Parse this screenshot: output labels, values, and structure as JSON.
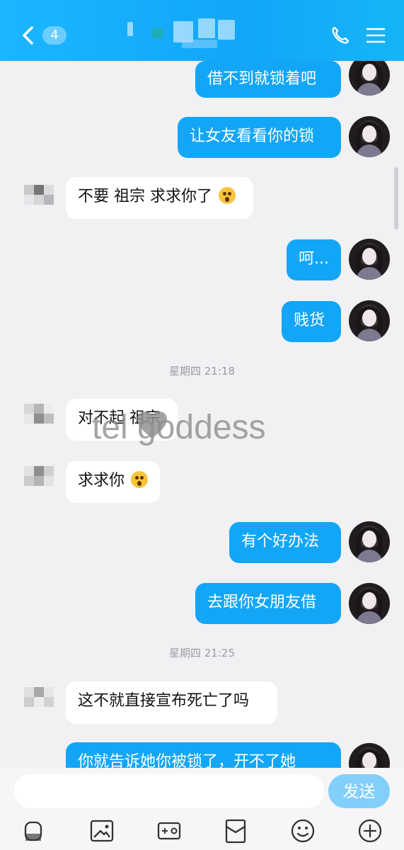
{
  "header": {
    "unread_badge": "4",
    "title_obscured": true
  },
  "messages": {
    "m1": "借不到就锁着吧",
    "m2": "让女友看看你的锁",
    "m3": "不要 祖宗 求求你了",
    "m4": "呵...",
    "m5": "贱货",
    "m6": "对不起 祖宗",
    "m7": "求求你",
    "m8": "有个好办法",
    "m9": "去跟你女朋友借",
    "m10": "这不就直接宣布死亡了吗",
    "m11": "你就告诉她你被锁了，开不了她"
  },
  "timestamps": {
    "t1": "星期四 21:18",
    "t2": "星期四 21:25"
  },
  "watermark": {
    "text": "tel goddess"
  },
  "composer": {
    "placeholder": "",
    "send_label": "发送"
  },
  "icons": {
    "back": "back-icon",
    "phone": "phone-icon",
    "menu": "menu-icon",
    "voice": "microphone-icon",
    "image": "image-icon",
    "video": "video-camera-icon",
    "red_packet": "red-packet-icon",
    "emoji": "emoji-icon",
    "add": "add-icon"
  },
  "colors": {
    "header": "#14aef8",
    "outgoing_bubble": "#13a6f7",
    "incoming_bubble": "#ffffff",
    "send_button": "#83cffb"
  }
}
